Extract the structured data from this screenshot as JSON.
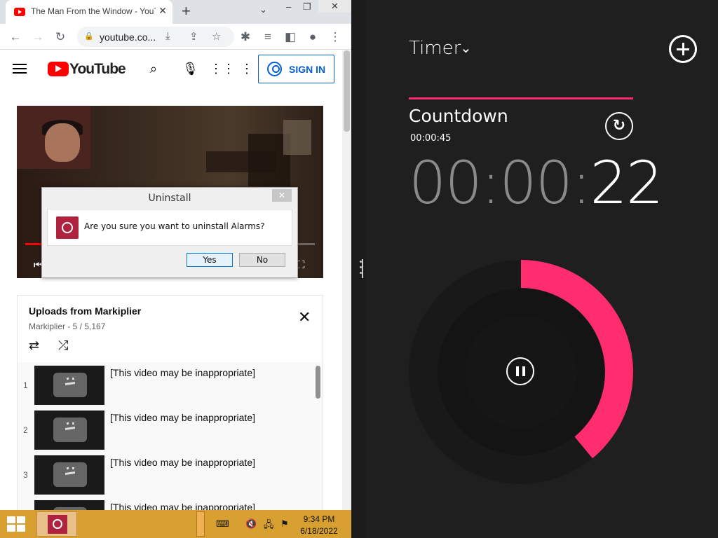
{
  "browser": {
    "tab_title": "The Man From the Window - YouTube",
    "tab_close": "✕",
    "new_tab": "+",
    "url": "youtube.co...",
    "window_controls": {
      "chevron": "⌄",
      "minimize": "–",
      "restore": "❐",
      "close": "✕"
    }
  },
  "youtube": {
    "logo_text": "YouTube",
    "sign_in_label": "SIGN IN"
  },
  "dialog": {
    "title": "Uninstall",
    "close": "✕",
    "message": "Are you sure you want to uninstall Alarms?",
    "yes_label": "Yes",
    "no_label": "No"
  },
  "playlist": {
    "title": "Uploads from Markiplier",
    "meta": "Markiplier - 5 / 5,167",
    "close": "✕",
    "items": [
      {
        "index": "1",
        "title": "[This video may be inappropriate]"
      },
      {
        "index": "2",
        "title": "[This video may be inappropriate]"
      },
      {
        "index": "3",
        "title": "[This video may be inappropriate]"
      },
      {
        "index": "",
        "title": "[This video may be inappropriate]"
      }
    ]
  },
  "taskbar": {
    "time": "9:34 PM",
    "date": "6/18/2022",
    "accent_color": "#d8a030"
  },
  "alarms_app": {
    "section_title": "Timer",
    "timer_name": "Countdown",
    "timer_total": "00:00:45",
    "remaining_dim": "00:00:",
    "remaining_bright": "22",
    "accent_color": "#ff2d6f",
    "remaining_fraction": 0.39
  }
}
